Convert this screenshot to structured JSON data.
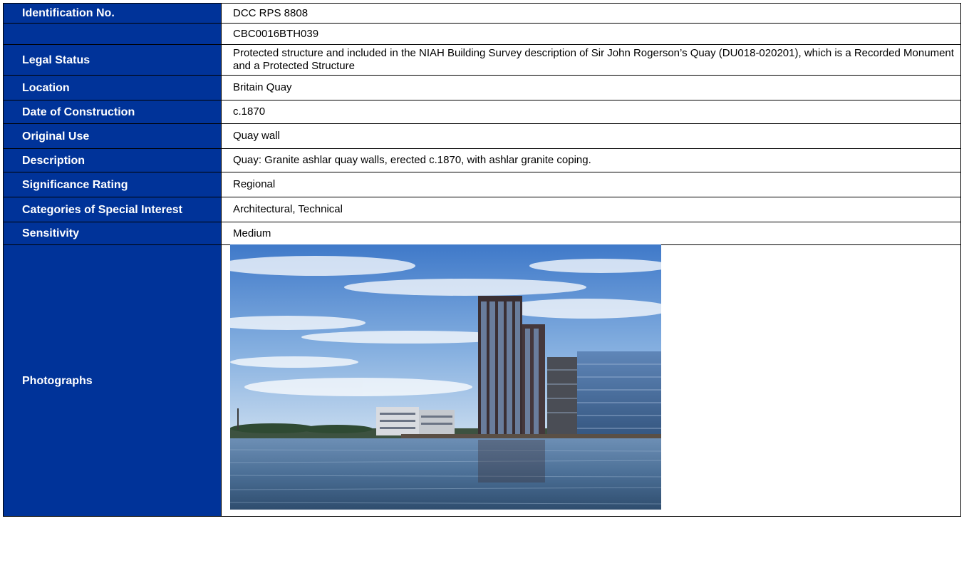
{
  "rows": [
    {
      "label": "Identification No.",
      "value": "DCC RPS 8808"
    },
    {
      "label": "",
      "value": "CBC0016BTH039"
    },
    {
      "label": "Legal Status",
      "value": "Protected structure and included in the NIAH Building Survey description of Sir John Rogerson’s Quay (DU018-020201), which is a Recorded Monument and a Protected Structure"
    },
    {
      "label": "Location",
      "value": "Britain Quay"
    },
    {
      "label": "Date of Construction",
      "value": "c.1870"
    },
    {
      "label": "Original Use",
      "value": "Quay wall"
    },
    {
      "label": "Description",
      "value": "Quay: Granite ashlar quay walls, erected c.1870, with ashlar granite coping."
    },
    {
      "label": "Significance Rating",
      "value": "Regional"
    },
    {
      "label": "Categories of Special Interest",
      "value": "Architectural, Technical"
    },
    {
      "label": "Sensitivity",
      "value": "Medium"
    },
    {
      "label": "Photographs",
      "value": ""
    }
  ],
  "colors": {
    "label_bg": "#003399",
    "label_text": "#ffffff",
    "border": "#000000"
  }
}
